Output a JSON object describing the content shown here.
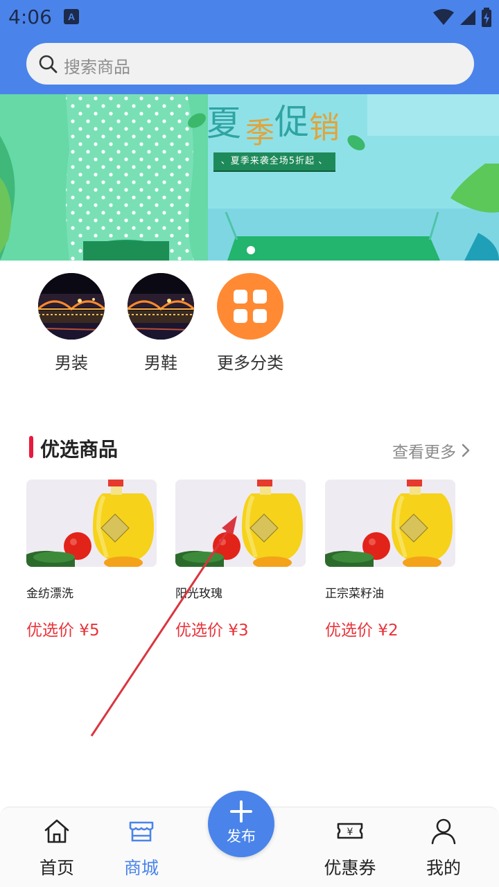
{
  "status_bar": {
    "time": "4:06",
    "notification_icon": "a-icon",
    "icons": [
      "wifi-icon",
      "signal-icon",
      "battery-charging-icon"
    ]
  },
  "search": {
    "placeholder": "搜索商品",
    "icon": "search-icon"
  },
  "banner": {
    "title_chars": [
      "夏",
      "季",
      "促",
      "销"
    ],
    "subtitle": "、夏季来袭全场5折起 、",
    "active_slide": 1,
    "slide_count": 1
  },
  "categories": [
    {
      "label": "男装",
      "image": "night-bridge-photo"
    },
    {
      "label": "男鞋",
      "image": "night-bridge-photo"
    },
    {
      "label": "更多分类",
      "icon": "grid-icon",
      "color": "#ff8a33"
    }
  ],
  "featured": {
    "title": "优选商品",
    "more_label": "查看更多",
    "accent_color": "#e8193c",
    "products": [
      {
        "name": "金纺漂洗",
        "price": "优选价 ¥5",
        "image": "cooking-oil-photo"
      },
      {
        "name": "阳光玫瑰",
        "price": "优选价 ¥3",
        "image": "cooking-oil-photo"
      },
      {
        "name": "正宗菜籽油",
        "price": "优选价 ¥2",
        "image": "cooking-oil-photo"
      }
    ]
  },
  "bottom_nav": {
    "items": [
      {
        "label": "首页",
        "icon": "home-icon",
        "active": false
      },
      {
        "label": "商城",
        "icon": "store-icon",
        "active": true
      },
      {
        "label": "优惠券",
        "icon": "coupon-icon",
        "active": false
      },
      {
        "label": "我的",
        "icon": "user-icon",
        "active": false
      }
    ],
    "publish_label": "发布",
    "accent_color": "#4a84ea"
  }
}
